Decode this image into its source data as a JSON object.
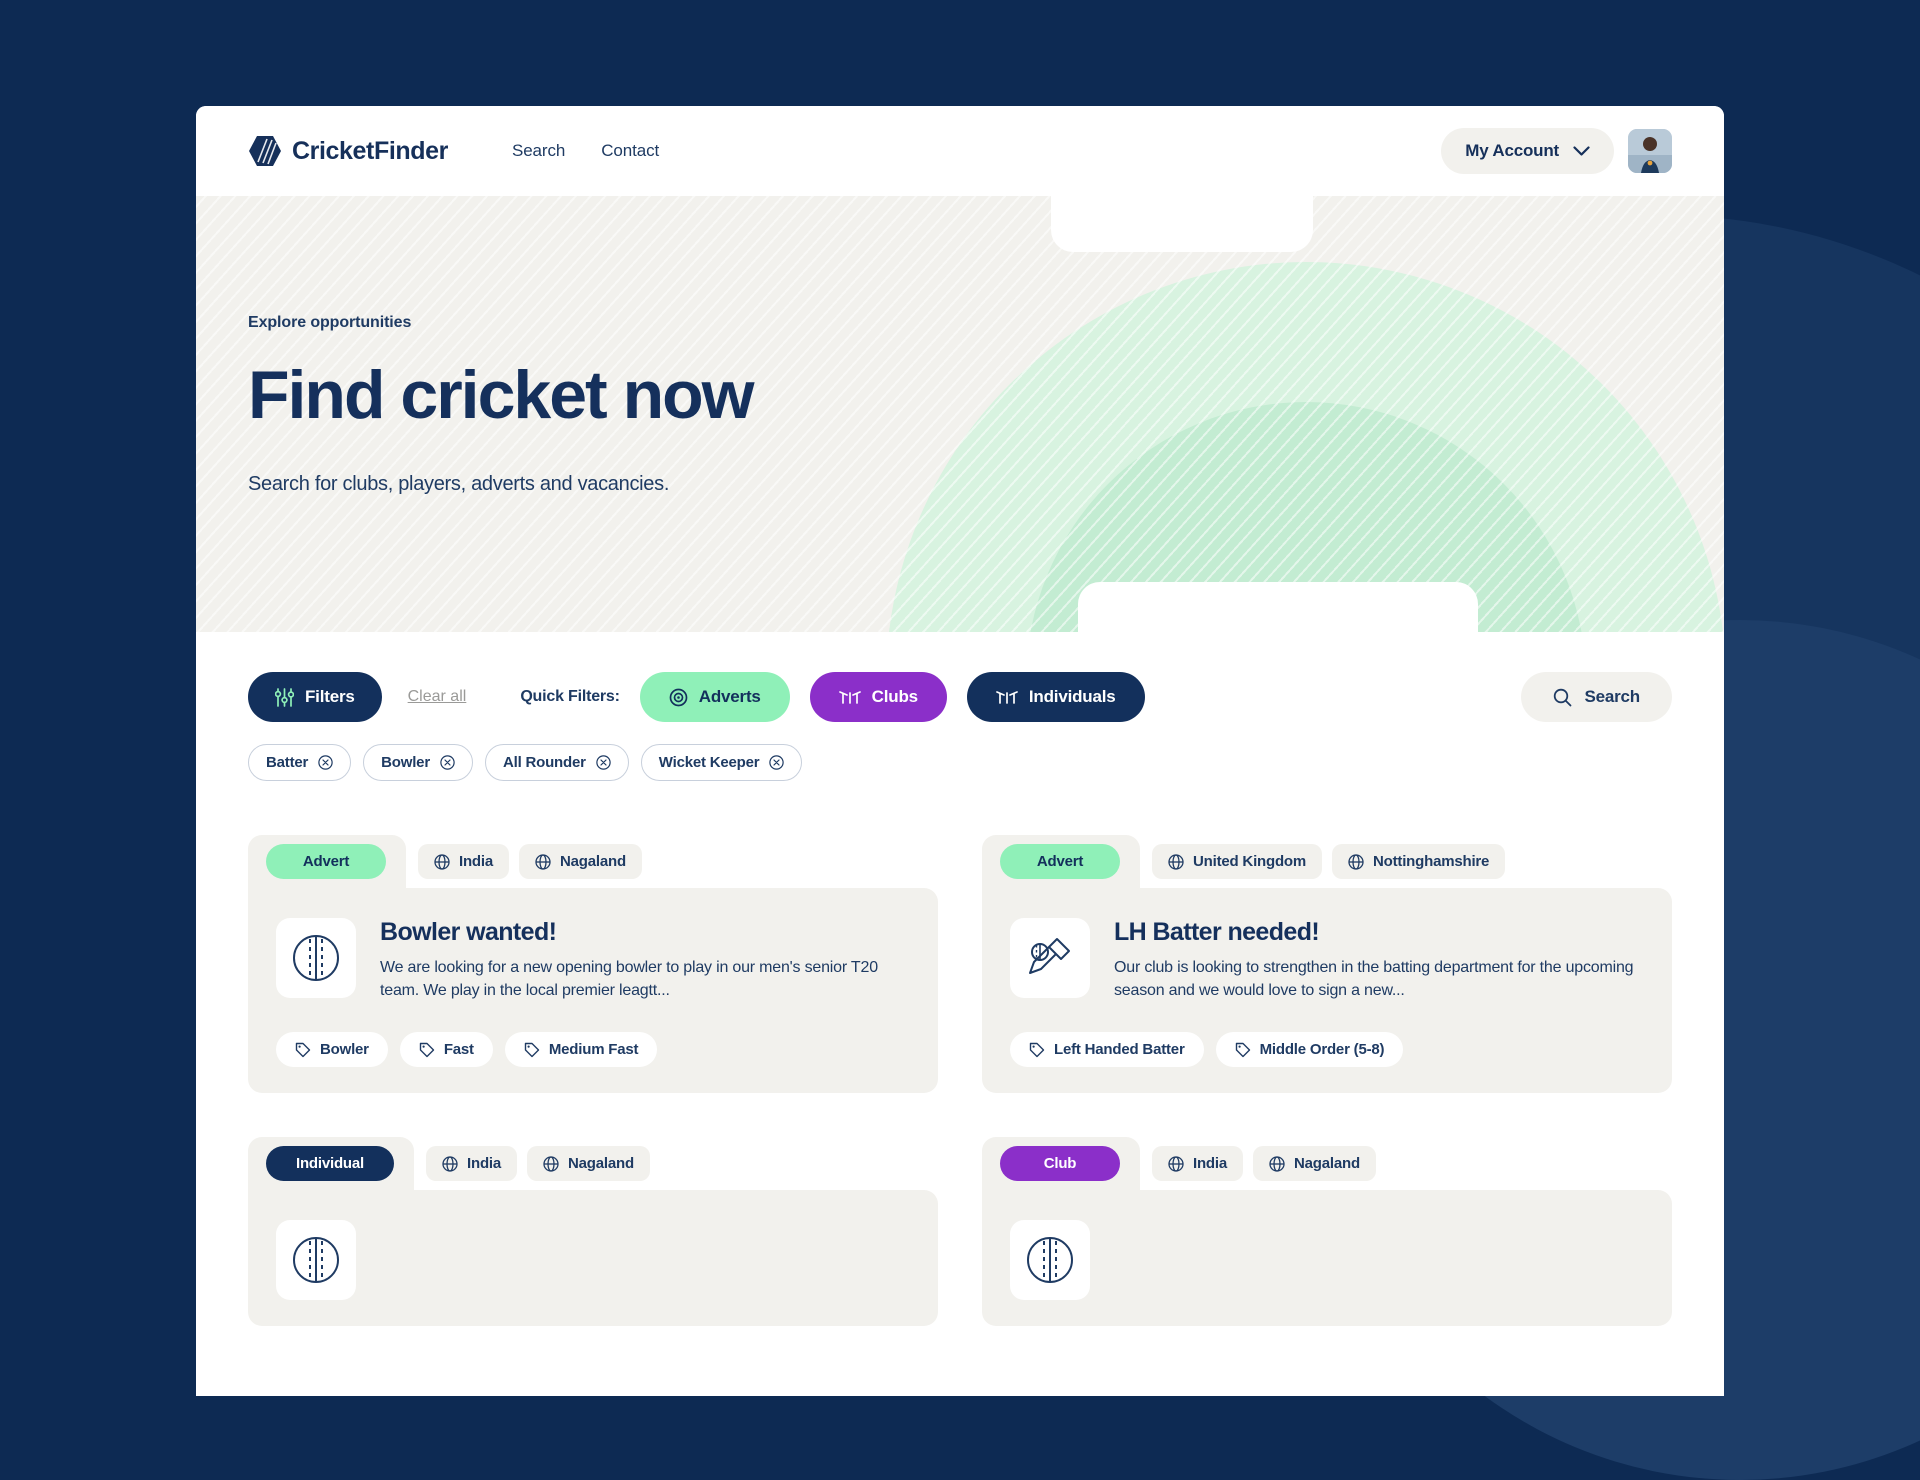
{
  "brand": {
    "name": "CricketFinder",
    "mark_icon": "cricketfinder-logo-icon"
  },
  "nav": {
    "items": [
      {
        "label": "Search"
      },
      {
        "label": "Contact"
      }
    ]
  },
  "account": {
    "label": "My Account",
    "chevron_icon": "chevron-down-icon",
    "avatar_icon": "user-avatar"
  },
  "hero": {
    "eyebrow": "Explore opportunities",
    "title": "Find cricket now",
    "subtitle": "Search for clubs, players, adverts and vacancies."
  },
  "filters": {
    "filters_label": "Filters",
    "filters_icon": "sliders-icon",
    "clear_all_label": "Clear all",
    "quick_filters_label": "Quick Filters:",
    "quick_filters": [
      {
        "label": "Adverts",
        "icon": "target-icon",
        "color": "#8ff0b8"
      },
      {
        "label": "Clubs",
        "icon": "wicket-icon",
        "color": "#8b2fc9"
      },
      {
        "label": "Individuals",
        "icon": "wicket-icon",
        "color": "#13305c"
      }
    ],
    "search_label": "Search",
    "search_icon": "search-icon",
    "chips": [
      {
        "label": "Batter",
        "remove_icon": "remove-circle-icon"
      },
      {
        "label": "Bowler",
        "remove_icon": "remove-circle-icon"
      },
      {
        "label": "All Rounder",
        "remove_icon": "remove-circle-icon"
      },
      {
        "label": "Wicket Keeper",
        "remove_icon": "remove-circle-icon"
      }
    ]
  },
  "results": [
    {
      "badge": "Advert",
      "badge_type": "advert",
      "locations": [
        {
          "label": "India"
        },
        {
          "label": "Nagaland"
        }
      ],
      "icon": "cricket-ball-icon",
      "title": "Bowler wanted!",
      "description": "We are looking for a new opening bowler to play in our men's senior T20 team. We play in the local premier leagtt...",
      "tags": [
        {
          "label": "Bowler"
        },
        {
          "label": "Fast"
        },
        {
          "label": "Medium Fast"
        }
      ]
    },
    {
      "badge": "Advert",
      "badge_type": "advert",
      "locations": [
        {
          "label": "United Kingdom"
        },
        {
          "label": "Nottinghamshire"
        }
      ],
      "icon": "cricket-bat-ball-icon",
      "title": "LH Batter needed!",
      "description": "Our club is looking to strengthen in the batting department for the upcoming season and we would love to sign a new...",
      "tags": [
        {
          "label": "Left Handed Batter"
        },
        {
          "label": "Middle Order (5-8)"
        }
      ]
    },
    {
      "badge": "Individual",
      "badge_type": "individual",
      "locations": [
        {
          "label": "India"
        },
        {
          "label": "Nagaland"
        }
      ],
      "icon": "cricket-ball-icon",
      "title": "",
      "description": "",
      "tags": []
    },
    {
      "badge": "Club",
      "badge_type": "club",
      "locations": [
        {
          "label": "India"
        },
        {
          "label": "Nagaland"
        }
      ],
      "icon": "cricket-ball-icon",
      "title": "",
      "description": "",
      "tags": []
    }
  ]
}
